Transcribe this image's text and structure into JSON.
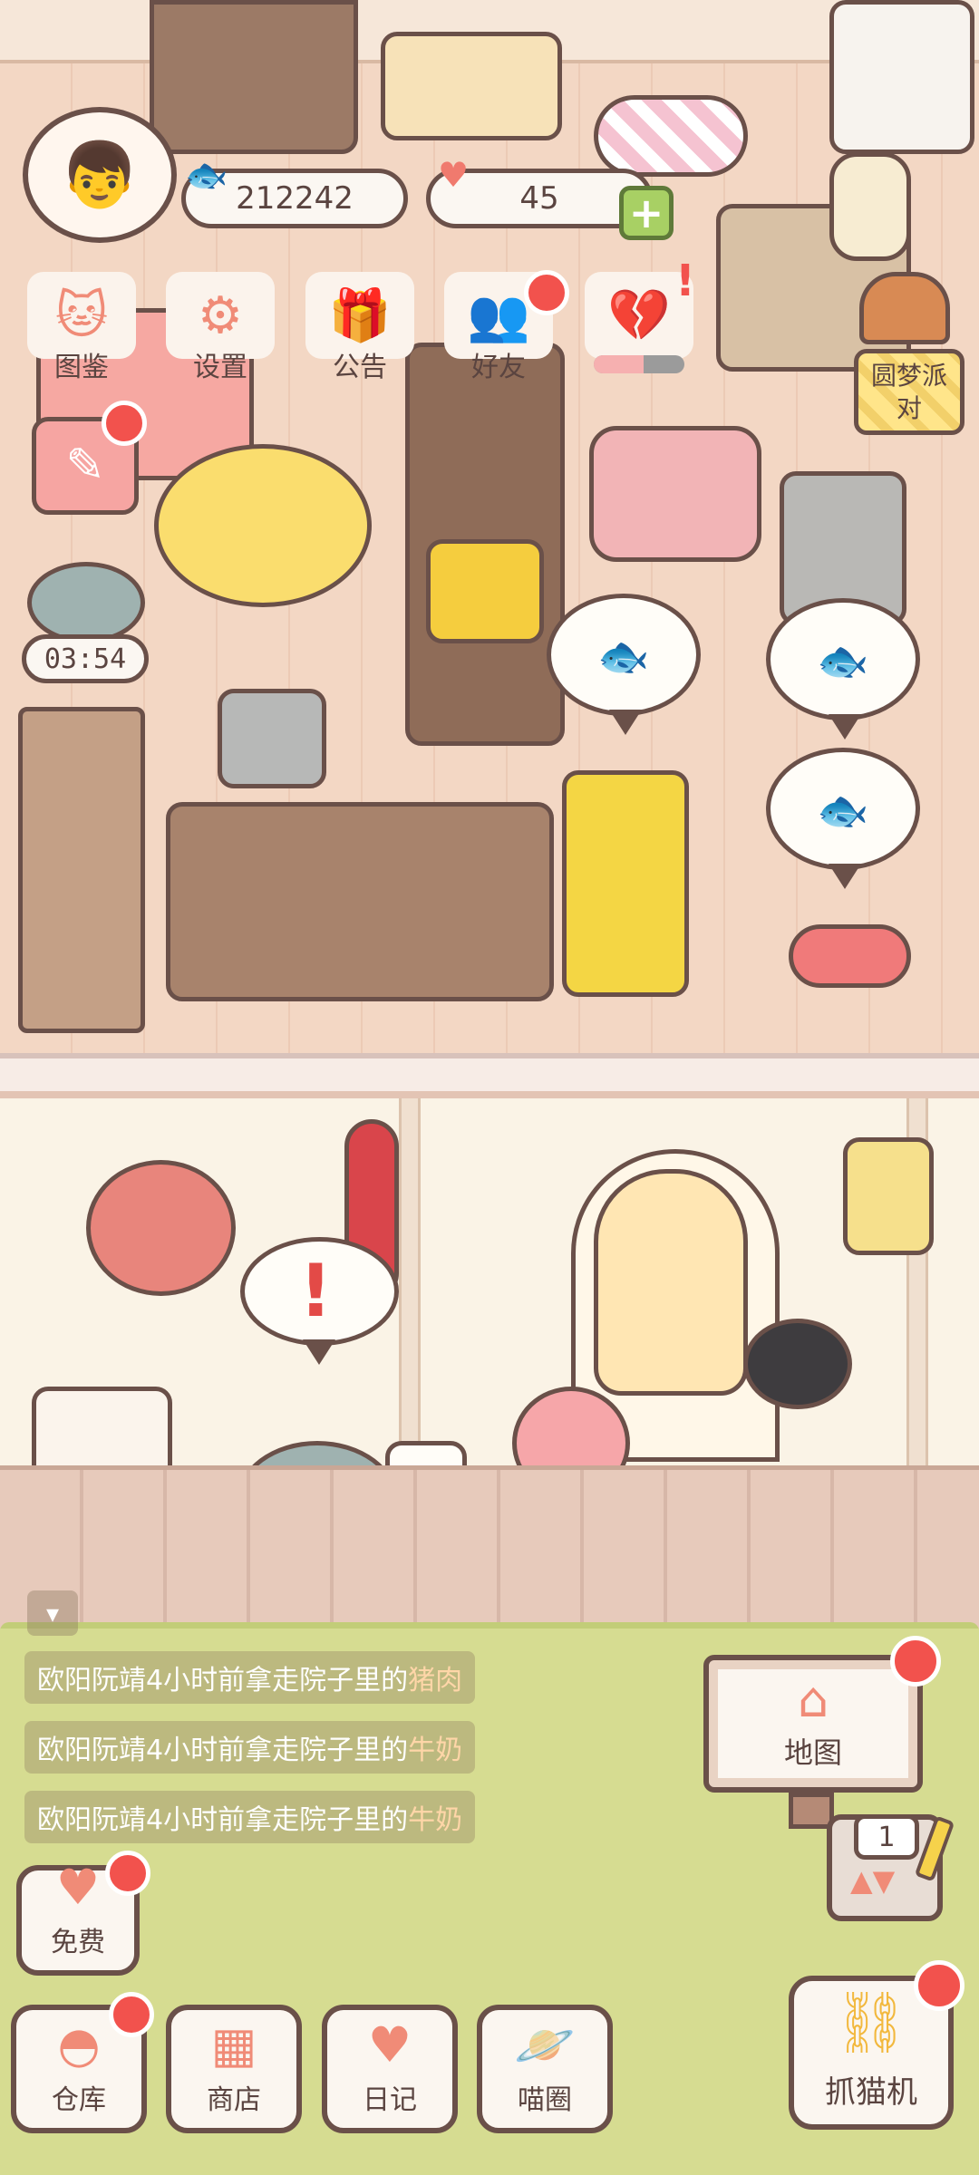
{
  "currency": {
    "fish_coins": "212242",
    "hearts": "45",
    "plus_symbol": "+"
  },
  "top_menu": [
    {
      "label": "图鉴",
      "icon": "cat-book-icon"
    },
    {
      "label": "设置",
      "icon": "gear-icon"
    },
    {
      "label": "公告",
      "icon": "gift-icon"
    },
    {
      "label": "好友",
      "icon": "friends-icon"
    },
    {
      "label": "",
      "icon": "broken-heart-icon"
    }
  ],
  "party_event": {
    "label": "圆梦派对"
  },
  "mouse_timer": "03:54",
  "activity_feed": [
    {
      "prefix": "欧阳阮靖",
      "middle": "4小时前拿走院子里的",
      "item": "猪肉"
    },
    {
      "prefix": "欧阳阮靖",
      "middle": "4小时前拿走院子里的",
      "item": "牛奶"
    },
    {
      "prefix": "欧阳阮靖",
      "middle": "4小时前拿走院子里的",
      "item": "牛奶"
    }
  ],
  "map_button": {
    "label": "地图"
  },
  "slot_machine": {
    "count": "1"
  },
  "free_button": {
    "label": "免费"
  },
  "bottom_nav": [
    {
      "label": "仓库",
      "icon": "warehouse-icon"
    },
    {
      "label": "商店",
      "icon": "shop-icon"
    },
    {
      "label": "日记",
      "icon": "diary-icon"
    },
    {
      "label": "喵圈",
      "icon": "planet-cat-icon"
    }
  ],
  "claw_machine": {
    "label": "抓猫机"
  },
  "colors": {
    "accent": "#f08b77",
    "badge_red": "#f2524d",
    "outline": "#6a5049",
    "lawn": "#d6dc91",
    "floor": "#f3d7c4"
  }
}
